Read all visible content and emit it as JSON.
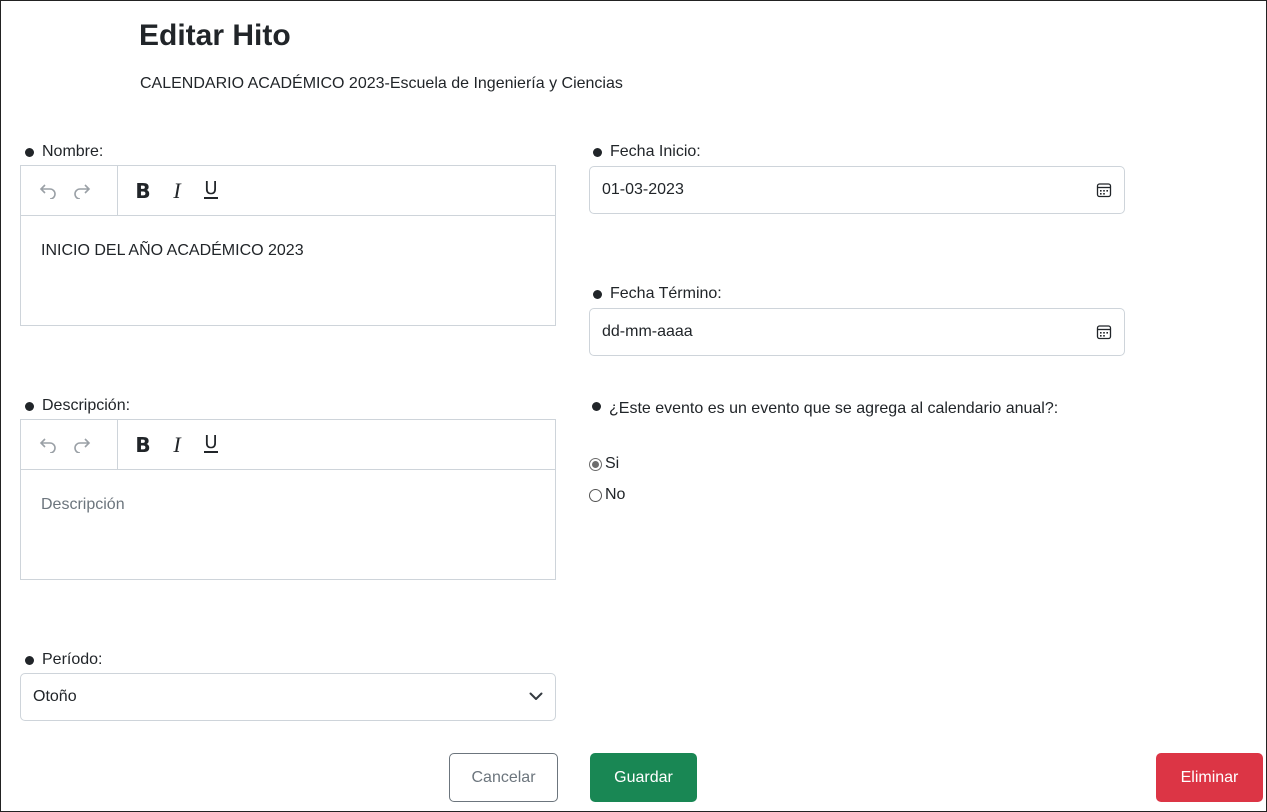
{
  "page": {
    "title": "Editar Hito",
    "subtitle": "CALENDARIO ACADÉMICO 2023-Escuela de Ingeniería y Ciencias"
  },
  "nombre": {
    "label": "Nombre:",
    "value": "INICIO DEL AÑO ACADÉMICO 2023"
  },
  "descripcion": {
    "label": "Descripción:",
    "placeholder": "Descripción"
  },
  "periodo": {
    "label": "Período:",
    "selected": "Otoño"
  },
  "fecha_inicio": {
    "label": "Fecha Inicio:",
    "value": "01-03-2023"
  },
  "fecha_termino": {
    "label": "Fecha Término:",
    "value": "dd-mm-aaaa"
  },
  "calendario_anual": {
    "question": "¿Este evento es un evento que se agrega al calendario anual?:",
    "options": [
      {
        "label": "Si",
        "checked": true
      },
      {
        "label": "No",
        "checked": false
      }
    ]
  },
  "toolbar": {
    "undo_icon": "undo-icon",
    "redo_icon": "redo-icon",
    "bold": "B",
    "italic": "I",
    "underline": "U"
  },
  "buttons": {
    "cancel": "Cancelar",
    "save": "Guardar",
    "delete": "Eliminar"
  },
  "colors": {
    "save": "#198754",
    "delete": "#dc3545",
    "cancel_border": "#6c757d"
  }
}
